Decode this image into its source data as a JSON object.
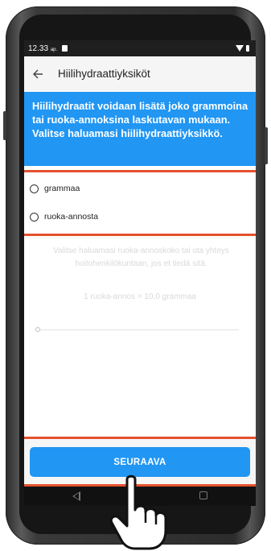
{
  "status_bar": {
    "time": "12.33",
    "time_suffix": "ap."
  },
  "app_bar": {
    "title": "Hiilihydraattiyksiköt",
    "back_icon": "arrow-left-icon"
  },
  "info_banner": {
    "text": "Hiilihydraatit voidaan lisätä joko grammoina tai ruoka-annoksina laskutavan mukaan. Valitse haluamasi hiilihydraattiyksikkö.",
    "color": "#2196f3"
  },
  "options": [
    {
      "label": "grammaa",
      "selected": false
    },
    {
      "label": "ruoka-annosta",
      "selected": false
    }
  ],
  "hint_text": "Valitse haluamasi ruoka-annoskoko tai ota yhteys hoitohenkilökuntaan, jos et tiedä sitä.",
  "portion_equivalence": "1 ruoka-annos = 10,0 grammaa",
  "slider": {
    "value": 0
  },
  "next_button": {
    "label": "SEURAAVA"
  },
  "highlight_color": "#e5512f",
  "accent_color": "#2196f3"
}
